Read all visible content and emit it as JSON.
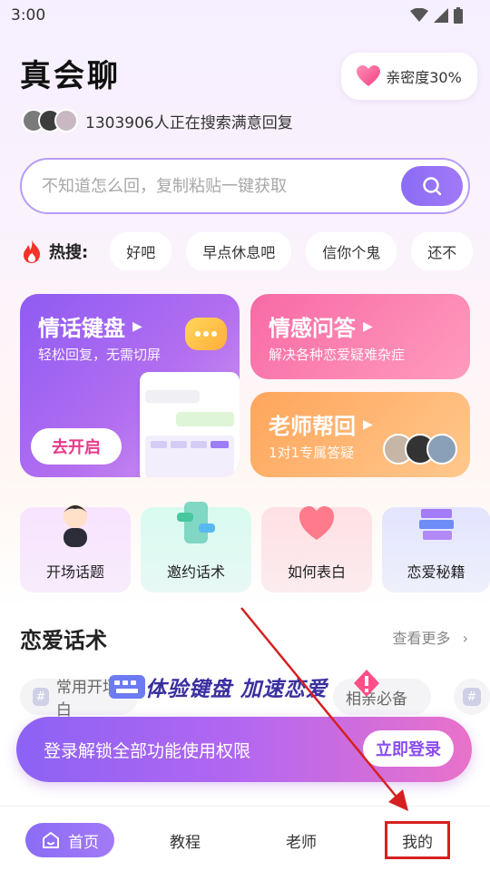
{
  "status": {
    "time": "3:00"
  },
  "header": {
    "title": "真会聊",
    "intimacy_label": "亲密度30%",
    "searching_text": "1303906人正在搜索满意回复"
  },
  "search": {
    "placeholder": "不知道怎么回，复制粘贴一键获取"
  },
  "hot": {
    "label": "热搜:",
    "chips": [
      "好吧",
      "早点休息吧",
      "信你个鬼",
      "还不"
    ]
  },
  "cards": {
    "keyboard": {
      "title": "情话键盘",
      "subtitle": "轻松回复，无需切屏",
      "button": "去开启"
    },
    "emotion": {
      "title": "情感问答",
      "subtitle": "解决各种恋爱疑难杂症"
    },
    "teacher": {
      "title": "老师帮回",
      "subtitle": "1对1专属答疑"
    }
  },
  "features": [
    "开场话题",
    "邀约话术",
    "如何表白",
    "恋爱秘籍"
  ],
  "section": {
    "title": "恋爱话术",
    "see_more": "查看更多"
  },
  "tags": [
    "常用开场白",
    "相亲必备"
  ],
  "promo": {
    "text": "体验键盘 加速恋爱"
  },
  "login": {
    "text": "登录解锁全部功能使用权限",
    "button": "立即登录"
  },
  "tabs": [
    "首页",
    "教程",
    "老师",
    "我的"
  ],
  "colors": {
    "accent": "#8b6cf6",
    "pink": "#f86aa5",
    "orange": "#ffa55b",
    "highlight": "#d62020"
  }
}
